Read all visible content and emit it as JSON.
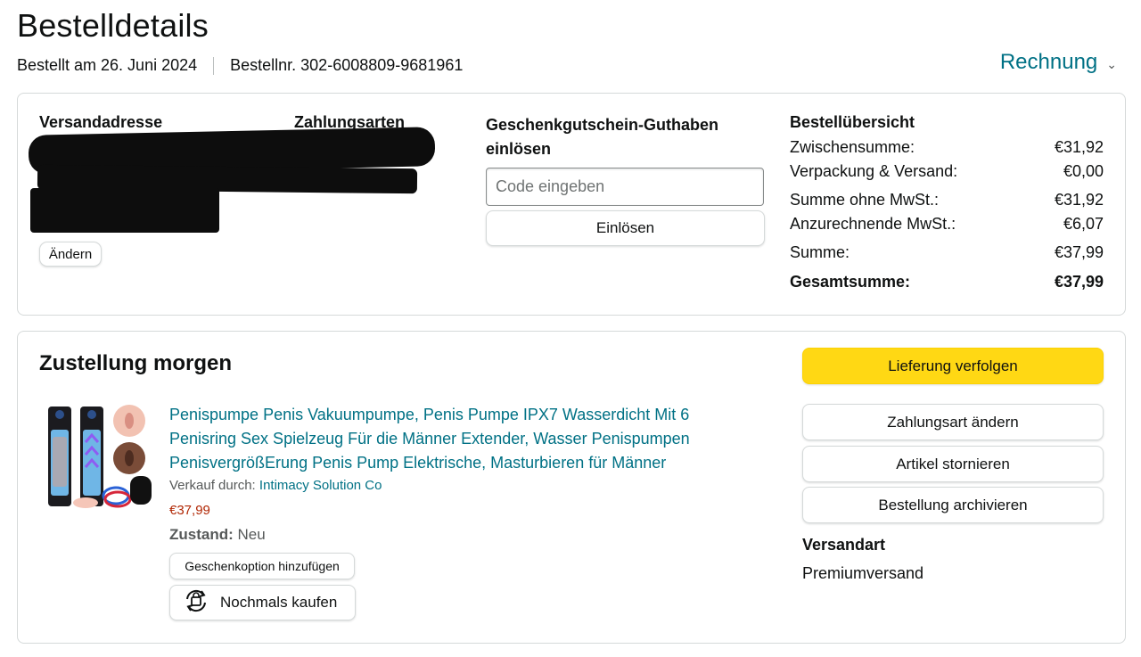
{
  "header": {
    "title": "Bestelldetails",
    "ordered_on": "Bestellt am 26. Juni 2024",
    "order_number": "Bestellnr. 302-6008809-9681961",
    "invoice_label": "Rechnung",
    "invoice_icon": "chevron-down-icon"
  },
  "info": {
    "shipping_address_label": "Versandadresse",
    "payment_methods_label": "Zahlungsarten",
    "change_label": "Ändern",
    "gift_card_label": "Geschenkgutschein-Guthaben einlösen",
    "code_placeholder": "Code eingeben",
    "redeem_label": "Einlösen"
  },
  "summary": {
    "title": "Bestellübersicht",
    "rows": [
      {
        "label": "Zwischensumme:",
        "value": "€31,92"
      },
      {
        "label": "Verpackung & Versand:",
        "value": "€0,00"
      },
      {
        "label": "Summe ohne MwSt.:",
        "value": "€31,92"
      },
      {
        "label": "Anzurechnende MwSt.:",
        "value": "€6,07"
      },
      {
        "label": "Summe:",
        "value": "€37,99"
      },
      {
        "label": "Gesamtsumme:",
        "value": "€37,99"
      }
    ]
  },
  "delivery": {
    "title": "Zustellung morgen",
    "product_title": "Penispumpe Penis Vakuumpumpe, Penis Pumpe IPX7 Wasserdicht Mit 6 Penisring Sex Spielzeug Für die Männer Extender, Wasser Penispumpen PenisvergrößErung Penis Pump Elektrische, Masturbieren für Männer",
    "sold_by_label": "Verkauf durch:",
    "seller": "Intimacy Solution Co",
    "price": "€37,99",
    "condition_label": "Zustand:",
    "condition_value": "Neu",
    "gift_option_label": "Geschenkoption hinzufügen",
    "buy_again_label": "Nochmals kaufen",
    "buy_again_icon": "buy-again-icon"
  },
  "actions": {
    "track": "Lieferung verfolgen",
    "change_payment": "Zahlungsart ändern",
    "cancel_item": "Artikel stornieren",
    "archive_order": "Bestellung archivieren",
    "shipping_type_label": "Versandart",
    "shipping_type_value": "Premiumversand"
  },
  "colors": {
    "link": "#007185",
    "primary_button": "#ffd814",
    "price": "#b12704",
    "border": "#d5d9d9"
  }
}
